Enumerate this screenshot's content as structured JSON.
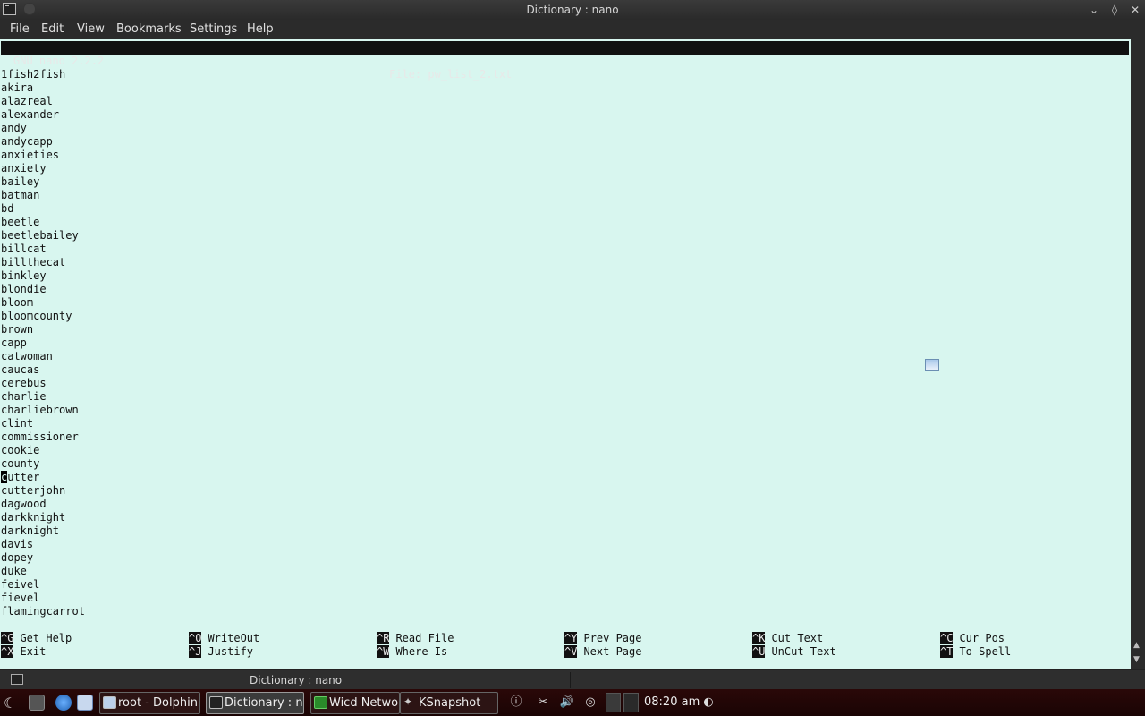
{
  "window": {
    "title": "Dictionary : nano"
  },
  "menu": [
    "File",
    "Edit",
    "View",
    "Bookmarks",
    "Settings",
    "Help"
  ],
  "nano": {
    "version": "GNU nano 2.2.2",
    "file_label": "File: pw_list_2.txt"
  },
  "lines": [
    "1fish2fish",
    "akira",
    "alazreal",
    "alexander",
    "andy",
    "andycapp",
    "anxieties",
    "anxiety",
    "bailey",
    "batman",
    "bd",
    "beetle",
    "beetlebailey",
    "billcat",
    "billthecat",
    "binkley",
    "blondie",
    "bloom",
    "bloomcounty",
    "brown",
    "capp",
    "catwoman",
    "caucas",
    "cerebus",
    "charlie",
    "charliebrown",
    "clint",
    "commissioner",
    "cookie",
    "county"
  ],
  "cursor_line": {
    "first_char": "c",
    "rest": "utter"
  },
  "lines_after": [
    "cutterjohn",
    "dagwood",
    "darkknight",
    "darknight",
    "davis",
    "dopey",
    "duke",
    "feivel",
    "fievel",
    "flamingcarrot"
  ],
  "shortcuts_row1": [
    {
      "key": "^G",
      "label": "Get Help"
    },
    {
      "key": "^O",
      "label": "WriteOut"
    },
    {
      "key": "^R",
      "label": "Read File"
    },
    {
      "key": "^Y",
      "label": "Prev Page"
    },
    {
      "key": "^K",
      "label": "Cut Text"
    },
    {
      "key": "^C",
      "label": "Cur Pos"
    }
  ],
  "shortcuts_row2": [
    {
      "key": "^X",
      "label": "Exit"
    },
    {
      "key": "^J",
      "label": "Justify"
    },
    {
      "key": "^W",
      "label": "Where Is"
    },
    {
      "key": "^V",
      "label": "Next Page"
    },
    {
      "key": "^U",
      "label": "UnCut Text"
    },
    {
      "key": "^T",
      "label": "To Spell"
    }
  ],
  "tabbar": {
    "label": "Dictionary : nano"
  },
  "taskbar": {
    "tasks": [
      {
        "label": "root - Dolphin"
      },
      {
        "label": "Dictionary : nano"
      },
      {
        "label": "Wicd Network"
      },
      {
        "label": "KSnapshot"
      }
    ],
    "clock": "08:20 am"
  },
  "colors": {
    "terminal_bg": "#d8f6ef",
    "panel_bg": "#1a0404"
  }
}
